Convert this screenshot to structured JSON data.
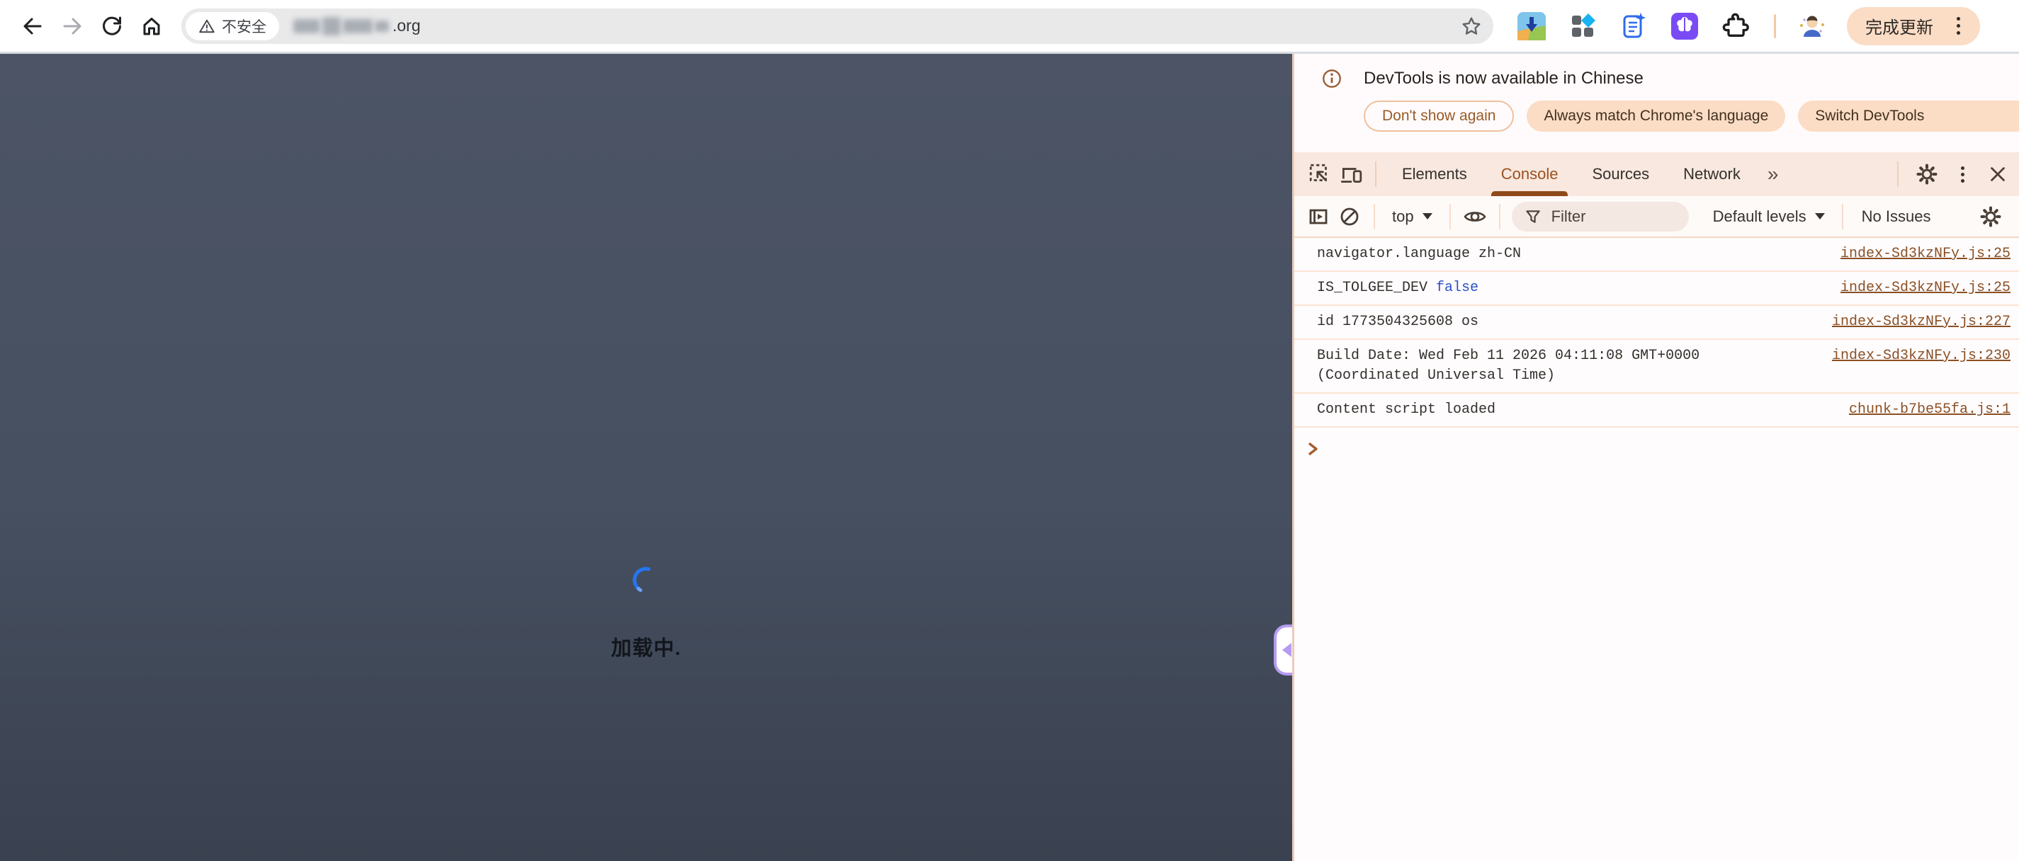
{
  "colors": {
    "accent_peach": "#fbdcc5",
    "devtools_link": "#8a5024",
    "console_tab_active": "#9c5120",
    "value_blue": "#2c50c8",
    "page_background_top": "#4c5466",
    "page_background_bottom": "#3a4150",
    "spinner_blue": "#2575f2",
    "handle_purple": "#b49cf2",
    "omnibox_bg": "#e9e9ea"
  },
  "browser": {
    "security_label": "不安全",
    "url_suffix": ".org",
    "update_label": "完成更新"
  },
  "page": {
    "loading_label": "加载中."
  },
  "devtools": {
    "infobar": {
      "title": "DevTools is now available in Chinese",
      "dismiss_label": "Don't show again",
      "match_label": "Always match Chrome's language",
      "switch_label": "Switch DevTools"
    },
    "tabs": {
      "elements": "Elements",
      "console": "Console",
      "sources": "Sources",
      "network": "Network",
      "more": "»"
    },
    "toolbar": {
      "context_label": "top",
      "filter_placeholder": "Filter",
      "levels_label": "Default levels",
      "issues_label": "No Issues"
    },
    "console": {
      "messages": [
        {
          "text": "navigator.language zh-CN",
          "source": "index-Sd3kzNFy.js:25"
        },
        {
          "text": "IS_TOLGEE_DEV",
          "value": "false",
          "source": "index-Sd3kzNFy.js:25"
        },
        {
          "text": "id 1773504325608 os",
          "source": "index-Sd3kzNFy.js:227"
        },
        {
          "text": "Build Date: Wed Feb 11 2026 04:11:08 GMT+0000 (Coordinated Universal Time)",
          "source": "index-Sd3kzNFy.js:230"
        },
        {
          "text": "Content script loaded",
          "source": "chunk-b7be55fa.js:1"
        }
      ]
    }
  }
}
